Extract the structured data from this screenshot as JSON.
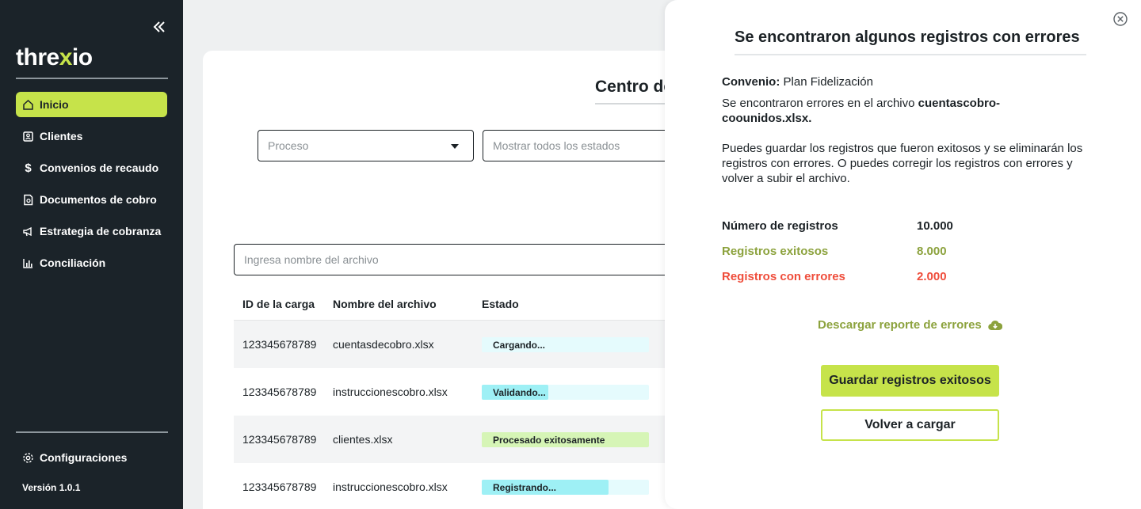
{
  "sidebar": {
    "logo_prefix": "thre",
    "logo_x": "x",
    "logo_suffix": "io",
    "items": [
      {
        "label": "Inicio",
        "icon": "home-icon"
      },
      {
        "label": "Clientes",
        "icon": "clients-icon"
      },
      {
        "label": "Convenios de recaudo",
        "icon": "dollar-icon"
      },
      {
        "label": "Documentos de cobro",
        "icon": "document-icon"
      },
      {
        "label": "Estrategia de cobranza",
        "icon": "megaphone-icon"
      },
      {
        "label": "Conciliación",
        "icon": "chart-icon"
      }
    ],
    "settings_label": "Configuraciones",
    "version": "Versión 1.0.1"
  },
  "main": {
    "title": "Centro de",
    "filters": {
      "process_placeholder": "Proceso",
      "status_placeholder": "Mostrar todos los estados"
    },
    "search_placeholder": "Ingresa nombre del archivo",
    "table": {
      "headers": [
        "ID de la carga",
        "Nombre del archivo",
        "Estado"
      ],
      "rows": [
        {
          "id": "123345678789",
          "file": "cuentasdecobro.xlsx",
          "status": "Cargando...",
          "progress": 0.05,
          "color": "#e5fbfd"
        },
        {
          "id": "123345678789",
          "file": "instruccionescobro.xlsx",
          "status": "Validando...",
          "progress": 0.4,
          "color": "#9ef0f5"
        },
        {
          "id": "123345678789",
          "file": "clientes.xlsx",
          "status": "Procesado exitosamente",
          "progress": 1.0,
          "color": "#d6f5b6"
        },
        {
          "id": "123345678789",
          "file": "instruccionescobro.xlsx",
          "status": "Registrando...",
          "progress": 0.76,
          "color": "#9ef0f5"
        }
      ]
    }
  },
  "modal": {
    "title": "Se encontraron algunos registros con errores",
    "agreement_label": "Convenio:",
    "agreement_value": "Plan Fidelización",
    "error_prefix": "Se encontraron errores en el archivo",
    "error_file": "cuentascobro-coounidos.xlsx.",
    "description": "Puedes guardar los registros que fueron exitosos y se eliminarán los registros con errores. O puedes corregir los registros con errores y volver a subir el archivo.",
    "stats": {
      "total_label": "Número de registros",
      "total_value": "10.000",
      "success_label": "Registros exitosos",
      "success_value": "8.000",
      "error_label": "Registros con errores",
      "error_value": "2.000"
    },
    "download_label": "Descargar reporte de errores",
    "save_label": "Guardar registros exitosos",
    "reload_label": "Volver a cargar"
  },
  "colors": {
    "accent": "#c6e34a",
    "sidebar_bg": "#1b2329",
    "success": "#8ca23d",
    "error": "#ef4d3b"
  }
}
